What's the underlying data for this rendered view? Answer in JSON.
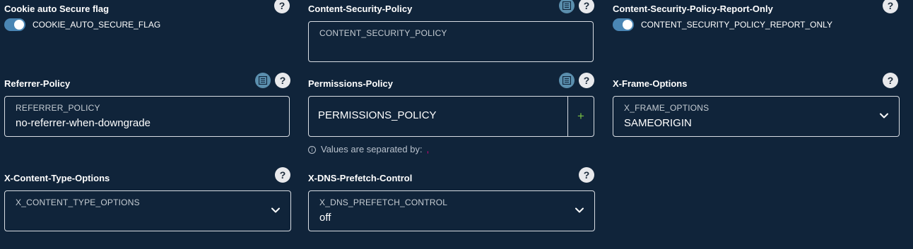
{
  "cookie_secure": {
    "label": "Cookie auto Secure flag",
    "toggle_label": "COOKIE_AUTO_SECURE_FLAG",
    "enabled": true
  },
  "csp": {
    "label": "Content-Security-Policy",
    "placeholder": "CONTENT_SECURITY_POLICY",
    "value": ""
  },
  "csp_report_only": {
    "label": "Content-Security-Policy-Report-Only",
    "toggle_label": "CONTENT_SECURITY_POLICY_REPORT_ONLY",
    "enabled": true
  },
  "referrer_policy": {
    "label": "Referrer-Policy",
    "placeholder": "REFERRER_POLICY",
    "value": "no-referrer-when-downgrade"
  },
  "permissions_policy": {
    "label": "Permissions-Policy",
    "input_text": "PERMISSIONS_POLICY",
    "add_symbol": "+",
    "hint": "Values are separated by:",
    "hint_info_symbol": "i",
    "separator": ","
  },
  "x_frame_options": {
    "label": "X-Frame-Options",
    "placeholder": "X_FRAME_OPTIONS",
    "value": "SAMEORIGIN"
  },
  "x_content_type_options": {
    "label": "X-Content-Type-Options",
    "placeholder": "X_CONTENT_TYPE_OPTIONS",
    "value": ""
  },
  "x_dns_prefetch_control": {
    "label": "X-DNS-Prefetch-Control",
    "placeholder": "X_DNS_PREFETCH_CONTROL",
    "value": "off"
  },
  "help_symbol": "?",
  "colors": {
    "background": "#10243a",
    "toggle_on": "#4a86b4",
    "editor_button": "#5b8fae",
    "add_plus": "#7ac043",
    "separator": "#e6007e"
  },
  "icons": {
    "help": "question-mark-icon",
    "editor": "text-editor-icon",
    "dropdown": "chevron-down-icon",
    "info": "info-circle-icon",
    "add": "plus-icon"
  }
}
